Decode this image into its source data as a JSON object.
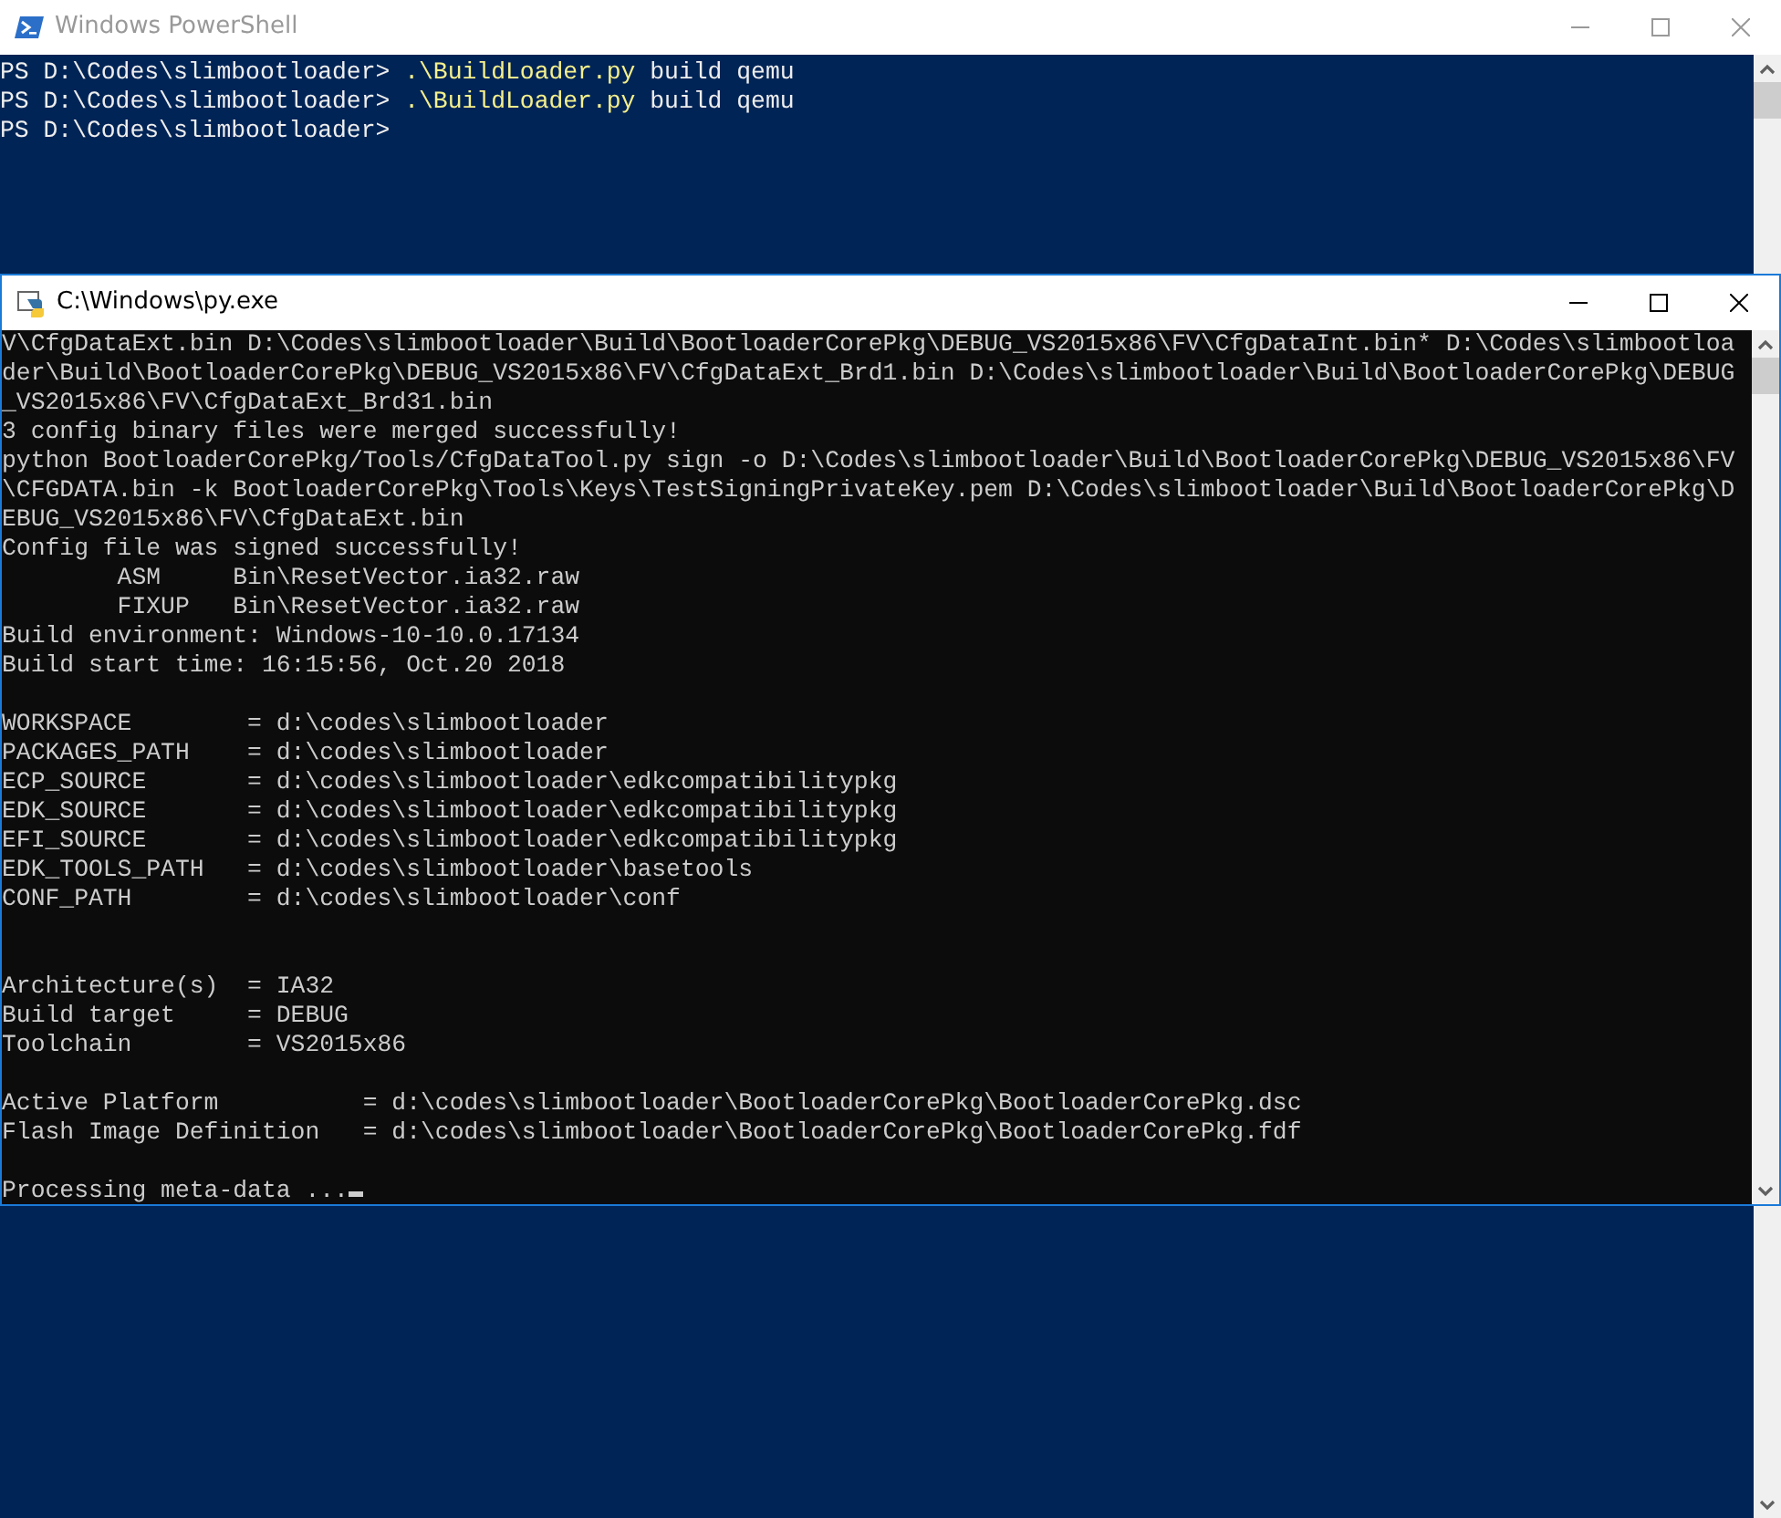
{
  "powershell_window": {
    "title": "Windows PowerShell",
    "active": false,
    "lines": [
      {
        "prompt": "PS D:\\Codes\\slimbootloader>",
        "command": ".\\BuildLoader.py",
        "args": "build qemu"
      },
      {
        "prompt": "PS D:\\Codes\\slimbootloader>",
        "command": ".\\BuildLoader.py",
        "args": "build qemu"
      },
      {
        "prompt": "PS D:\\Codes\\slimbootloader>"
      }
    ]
  },
  "py_window": {
    "title": "C:\\Windows\\py.exe",
    "active": true,
    "blocks": [
      {
        "lines": [
          "V\\CfgDataExt.bin D:\\Codes\\slimbootloader\\Build\\BootloaderCorePkg\\DEBUG_VS2015x86\\FV\\CfgDataInt.bin* D:\\Codes\\slimbootloa",
          "der\\Build\\BootloaderCorePkg\\DEBUG_VS2015x86\\FV\\CfgDataExt_Brd1.bin D:\\Codes\\slimbootloader\\Build\\BootloaderCorePkg\\DEBUG",
          "_VS2015x86\\FV\\CfgDataExt_Brd31.bin",
          "3 config binary files were merged successfully!",
          "python BootloaderCorePkg/Tools/CfgDataTool.py sign -o D:\\Codes\\slimbootloader\\Build\\BootloaderCorePkg\\DEBUG_VS2015x86\\FV",
          "\\CFGDATA.bin -k BootloaderCorePkg\\Tools\\Keys\\TestSigningPrivateKey.pem D:\\Codes\\slimbootloader\\Build\\BootloaderCorePkg\\D",
          "EBUG_VS2015x86\\FV\\CfgDataExt.bin",
          "Config file was signed successfully!",
          "        ASM     Bin\\ResetVector.ia32.raw",
          "        FIXUP   Bin\\ResetVector.ia32.raw",
          "Build environment: Windows-10-10.0.17134",
          "Build start time: 16:15:56, Oct.20 2018"
        ]
      },
      {
        "lines": [
          "WORKSPACE        = d:\\codes\\slimbootloader",
          "PACKAGES_PATH    = d:\\codes\\slimbootloader",
          "ECP_SOURCE       = d:\\codes\\slimbootloader\\edkcompatibilitypkg",
          "EDK_SOURCE       = d:\\codes\\slimbootloader\\edkcompatibilitypkg",
          "EFI_SOURCE       = d:\\codes\\slimbootloader\\edkcompatibilitypkg",
          "EDK_TOOLS_PATH   = d:\\codes\\slimbootloader\\basetools",
          "CONF_PATH        = d:\\codes\\slimbootloader\\conf"
        ]
      },
      {
        "lines": [
          "Architecture(s)  = IA32",
          "Build target     = DEBUG",
          "Toolchain        = VS2015x86"
        ]
      },
      {
        "lines": [
          "Active Platform          = d:\\codes\\slimbootloader\\BootloaderCorePkg\\BootloaderCorePkg.dsc",
          "Flash Image Definition   = d:\\codes\\slimbootloader\\BootloaderCorePkg\\BootloaderCorePkg.fdf"
        ]
      },
      {
        "lines": [
          "Processing meta-data ..."
        ],
        "cursor": true
      }
    ]
  }
}
